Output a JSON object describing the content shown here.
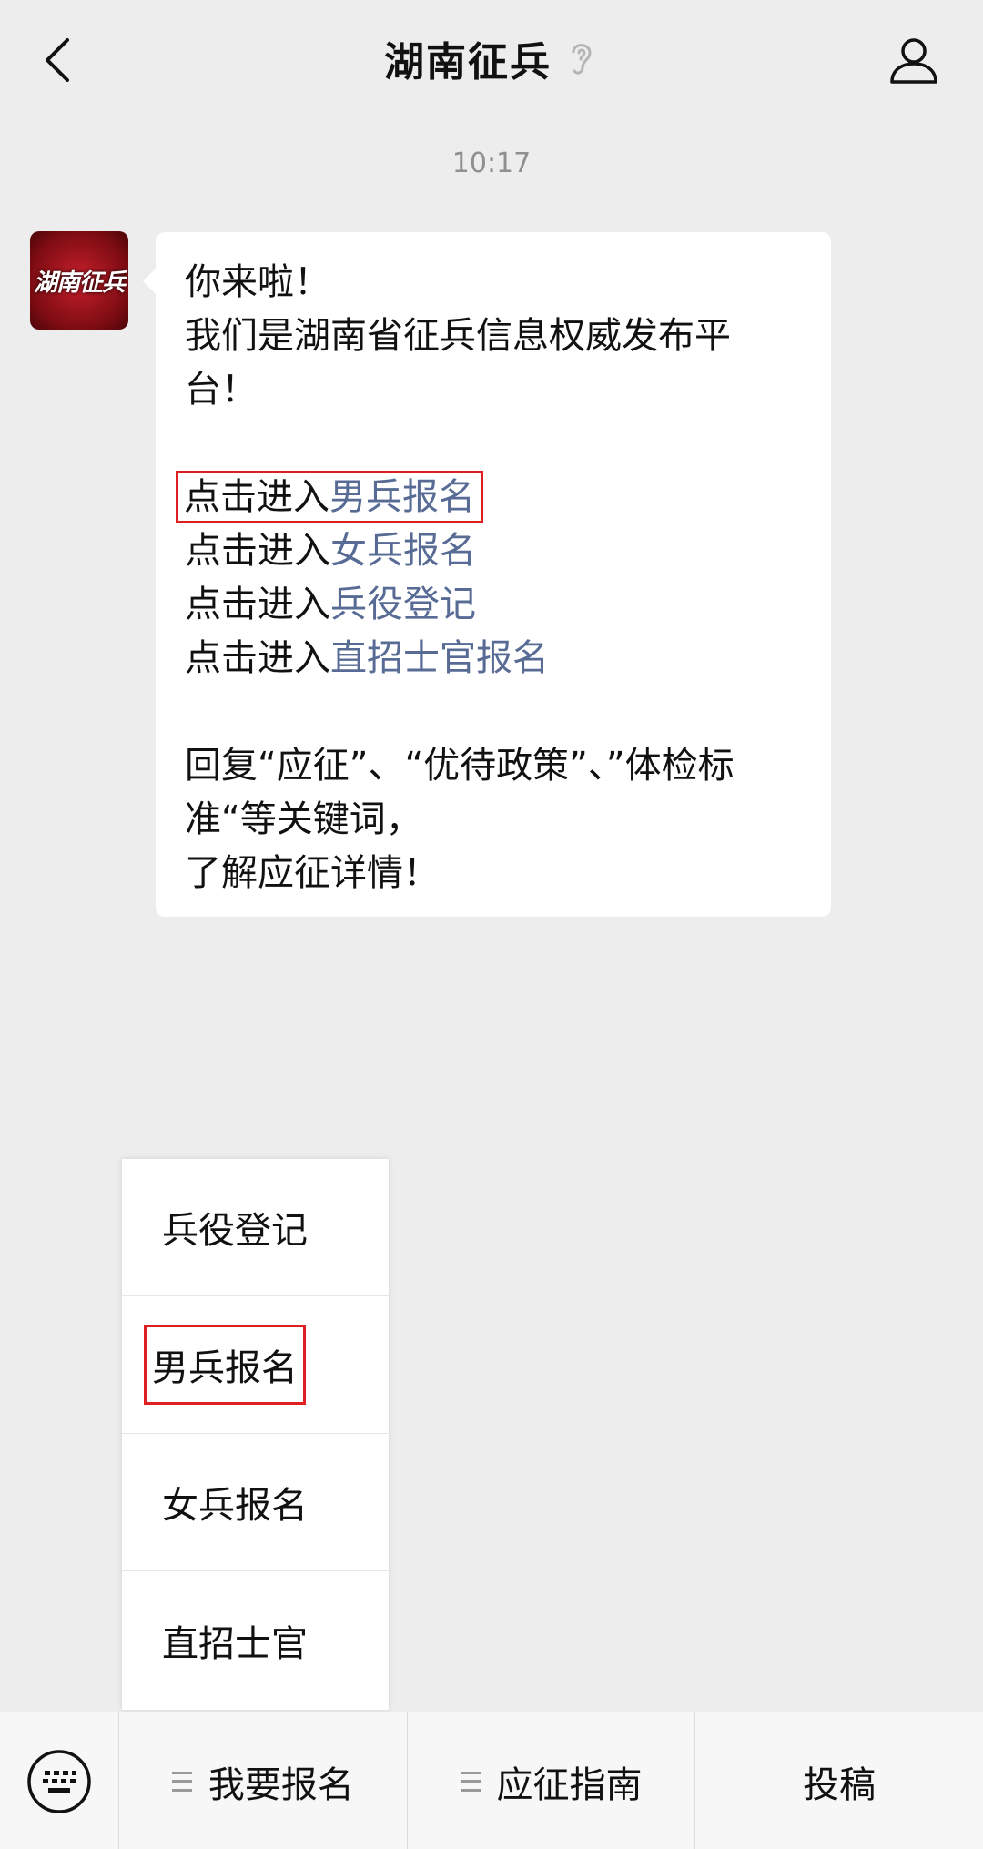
{
  "header": {
    "title": "湖南征兵"
  },
  "chat": {
    "timestamp": "10:17",
    "avatar_text": "湖南征兵",
    "message": {
      "greeting": "你来啦！",
      "intro_line1": "我们是湖南省征兵信息权威发布平",
      "intro_line2": "台！",
      "prefix": "点击进入",
      "links": [
        "男兵报名",
        "女兵报名",
        "兵役登记",
        "直招士官报名"
      ],
      "reply_line1": "回复“应征”、“优待政策”、”体检标",
      "reply_line2": "准“等关键词，",
      "reply_line3": "了解应征详情！"
    }
  },
  "popup_menu": {
    "items": [
      "兵役登记",
      "男兵报名",
      "女兵报名",
      "直招士官"
    ]
  },
  "bottom_menu": {
    "tabs": [
      "我要报名",
      "应征指南",
      "投稿"
    ]
  },
  "colors": {
    "link": "#576b95",
    "highlight": "#e02020",
    "background": "#ededed"
  }
}
